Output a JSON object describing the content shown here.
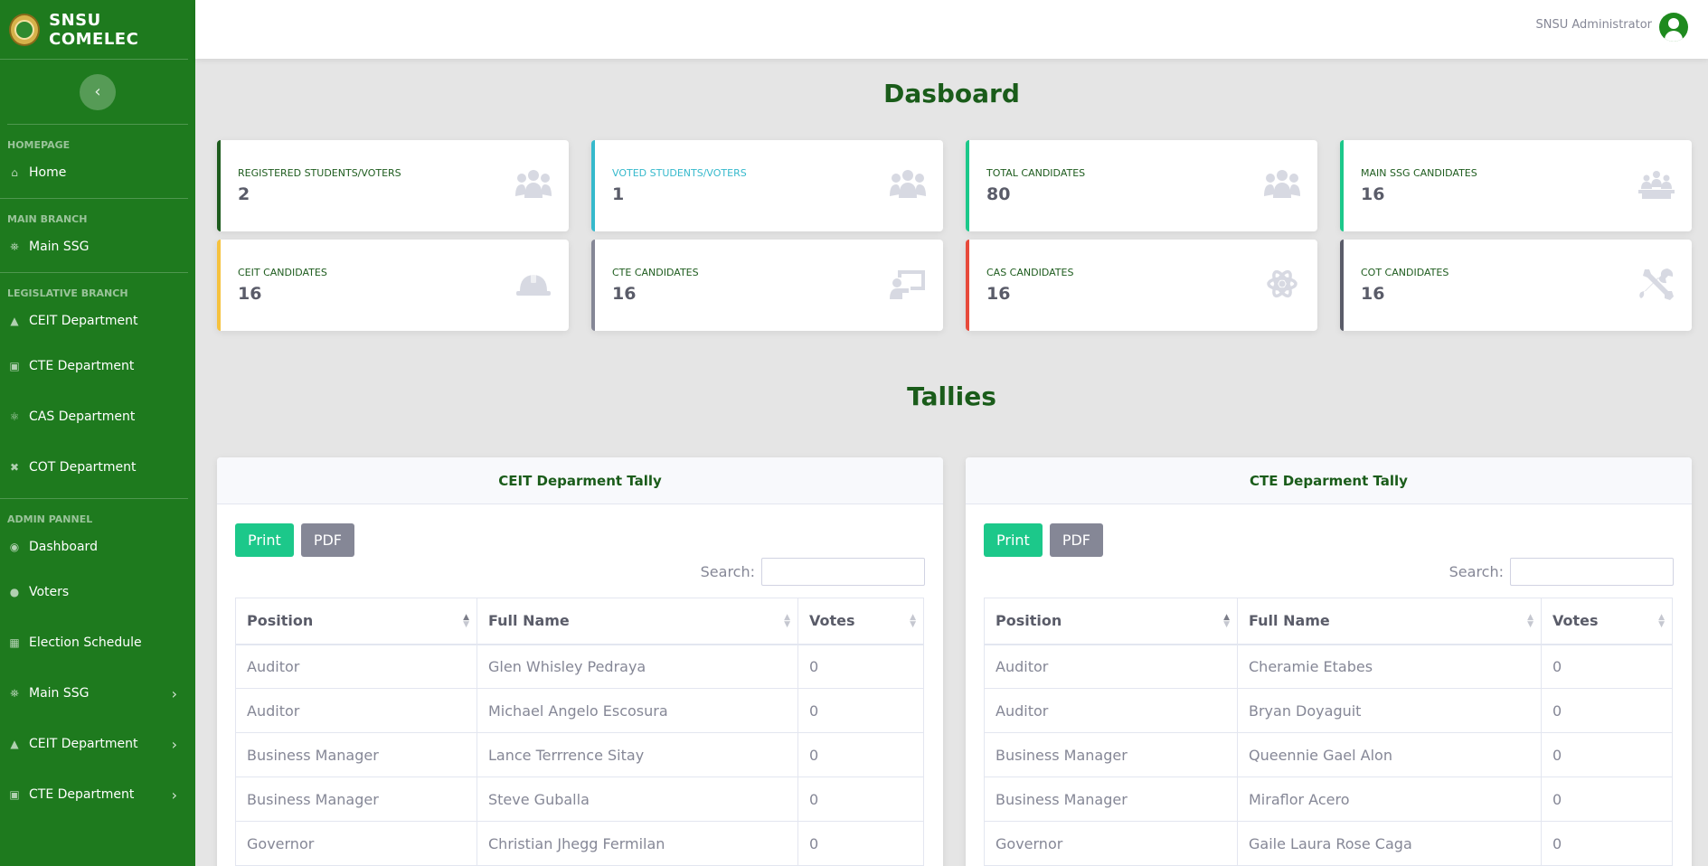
{
  "brand": {
    "name": "SNSU COMELEC"
  },
  "sidebar": {
    "sections": [
      {
        "heading": "HOMEPAGE",
        "items": [
          {
            "label": "Home",
            "icon": "home-icon"
          }
        ]
      },
      {
        "heading": "MAIN BRANCH",
        "items": [
          {
            "label": "Main SSG",
            "icon": "landmark-icon"
          }
        ]
      },
      {
        "heading": "LEGISLATIVE BRANCH",
        "items": [
          {
            "label": "CEIT Department",
            "icon": "hard-hat-icon"
          },
          {
            "label": "CTE Department",
            "icon": "chalkboard-teacher-icon"
          },
          {
            "label": "CAS Department",
            "icon": "atom-icon"
          },
          {
            "label": "COT Department",
            "icon": "tools-icon"
          }
        ]
      },
      {
        "heading": "ADMIN PANNEL",
        "items": [
          {
            "label": "Dashboard",
            "icon": "dashboard-icon"
          },
          {
            "label": "Voters",
            "icon": "users-icon"
          },
          {
            "label": "Election Schedule",
            "icon": "calendar-icon"
          },
          {
            "label": "Main SSG",
            "icon": "landmark-icon",
            "has_submenu": true
          },
          {
            "label": "CEIT Department",
            "icon": "hard-hat-icon",
            "has_submenu": true
          },
          {
            "label": "CTE Department",
            "icon": "chalkboard-teacher-icon",
            "has_submenu": true
          }
        ]
      }
    ]
  },
  "topbar": {
    "user_name": "SNSU Administrator"
  },
  "dashboard": {
    "title": "Dasboard",
    "cards": [
      {
        "label": "REGISTERED STUDENTS/VOTERS",
        "value": "2",
        "accent": "#1e5c1e",
        "label_color": "#1e5c1e",
        "icon": "users-icon"
      },
      {
        "label": "VOTED STUDENTS/VOTERS",
        "value": "1",
        "accent": "#36b9cc",
        "label_color": "#36b9cc",
        "icon": "users-icon"
      },
      {
        "label": "TOTAL CANDIDATES",
        "value": "80",
        "accent": "#1cc88a",
        "label_color": "#1e5c1e",
        "icon": "users-icon"
      },
      {
        "label": "MAIN SSG CANDIDATES",
        "value": "16",
        "accent": "#1cc88a",
        "label_color": "#1e5c1e",
        "icon": "landmark-icon"
      },
      {
        "label": "CEIT CANDIDATES",
        "value": "16",
        "accent": "#f6c23e",
        "label_color": "#1e5c1e",
        "icon": "hard-hat-icon"
      },
      {
        "label": "CTE CANDIDATES",
        "value": "16",
        "accent": "#858796",
        "label_color": "#1e5c1e",
        "icon": "chalkboard-teacher-icon"
      },
      {
        "label": "CAS CANDIDATES",
        "value": "16",
        "accent": "#e74a3b",
        "label_color": "#1e5c1e",
        "icon": "atom-icon"
      },
      {
        "label": "COT CANDIDATES",
        "value": "16",
        "accent": "#5a5c69",
        "label_color": "#1e5c1e",
        "icon": "tools-icon"
      }
    ]
  },
  "tallies": {
    "title": "Tallies",
    "panels": [
      {
        "title": "CEIT Deparment Tally",
        "print_label": "Print",
        "pdf_label": "PDF",
        "search_label": "Search:",
        "columns": [
          "Position",
          "Full Name",
          "Votes"
        ],
        "rows": [
          [
            "Auditor",
            "Glen Whisley Pedraya",
            "0"
          ],
          [
            "Auditor",
            "Michael Angelo Escosura",
            "0"
          ],
          [
            "Business Manager",
            "Lance Terrrence Sitay",
            "0"
          ],
          [
            "Business Manager",
            "Steve Guballa",
            "0"
          ],
          [
            "Governor",
            "Christian Jhegg Fermilan",
            "0"
          ]
        ]
      },
      {
        "title": "CTE Deparment Tally",
        "print_label": "Print",
        "pdf_label": "PDF",
        "search_label": "Search:",
        "columns": [
          "Position",
          "Full Name",
          "Votes"
        ],
        "rows": [
          [
            "Auditor",
            "Cheramie Etabes",
            "0"
          ],
          [
            "Auditor",
            "Bryan Doyaguit",
            "0"
          ],
          [
            "Business Manager",
            "Queennie Gael Alon",
            "0"
          ],
          [
            "Business Manager",
            "Miraflor Acero",
            "0"
          ],
          [
            "Governor",
            "Gaile Laura Rose Caga",
            "0"
          ]
        ]
      }
    ]
  }
}
